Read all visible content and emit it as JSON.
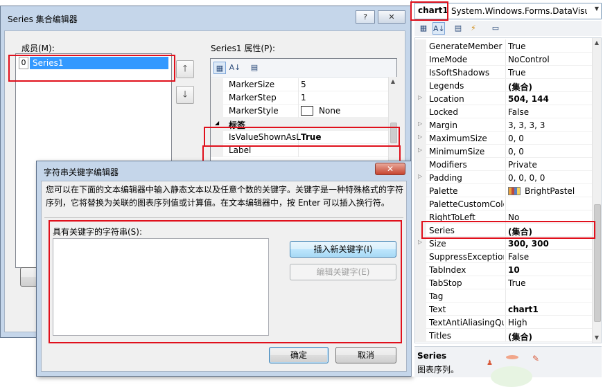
{
  "series_editor": {
    "title": "Series 集合编辑器",
    "help_button": "?",
    "close_button": "✕",
    "members_label": "成员(M):",
    "members": [
      {
        "index": "0",
        "name": "Series1"
      }
    ],
    "properties_label": "Series1 属性(P):",
    "properties": [
      {
        "name": "MarkerSize",
        "value": "5"
      },
      {
        "name": "MarkerStep",
        "value": "1"
      },
      {
        "name": "MarkerStyle",
        "value": "None"
      }
    ],
    "category_label": "标签",
    "is_value_shown": {
      "name": "IsValueShownAsL",
      "value": "True"
    },
    "label_prop": {
      "name": "Label",
      "value": ""
    }
  },
  "keyword_editor": {
    "title": "字符串关键字编辑器",
    "description": "您可以在下面的文本编辑器中输入静态文本以及任意个数的关键字。关键字是一种特殊格式的字符序列，它将替换为关联的图表序列值或计算值。在文本编辑器中，按 Enter 可以插入换行符。",
    "string_label": "具有关键字的字符串(S):",
    "text_value": "",
    "insert_button": "插入新关键字(I)",
    "edit_button": "编辑关键字(E)",
    "ok_button": "确定",
    "cancel_button": "取消"
  },
  "properties_window": {
    "object_name": "chart1",
    "object_type": "System.Windows.Forms.DataVisualiz",
    "rows": [
      {
        "name": "GenerateMember",
        "value": "True",
        "bold": false,
        "expandable": false
      },
      {
        "name": "ImeMode",
        "value": "NoControl",
        "bold": false,
        "expandable": false
      },
      {
        "name": "IsSoftShadows",
        "value": "True",
        "bold": false,
        "expandable": false
      },
      {
        "name": "Legends",
        "value": "(集合)",
        "bold": true,
        "expandable": false
      },
      {
        "name": "Location",
        "value": "504, 144",
        "bold": true,
        "expandable": true
      },
      {
        "name": "Locked",
        "value": "False",
        "bold": false,
        "expandable": false
      },
      {
        "name": "Margin",
        "value": "3, 3, 3, 3",
        "bold": false,
        "expandable": true
      },
      {
        "name": "MaximumSize",
        "value": "0, 0",
        "bold": false,
        "expandable": true
      },
      {
        "name": "MinimumSize",
        "value": "0, 0",
        "bold": false,
        "expandable": true
      },
      {
        "name": "Modifiers",
        "value": "Private",
        "bold": false,
        "expandable": false
      },
      {
        "name": "Padding",
        "value": "0, 0, 0, 0",
        "bold": false,
        "expandable": true
      },
      {
        "name": "Palette",
        "value": "BrightPastel",
        "bold": false,
        "expandable": false
      },
      {
        "name": "PaletteCustomColo",
        "value": "",
        "bold": false,
        "expandable": false
      },
      {
        "name": "RightToLeft",
        "value": "No",
        "bold": false,
        "expandable": false
      },
      {
        "name": "Series",
        "value": "(集合)",
        "bold": true,
        "expandable": false
      },
      {
        "name": "Size",
        "value": "300, 300",
        "bold": true,
        "expandable": true
      },
      {
        "name": "SuppressExceptions",
        "value": "False",
        "bold": false,
        "expandable": false
      },
      {
        "name": "TabIndex",
        "value": "10",
        "bold": true,
        "expandable": false
      },
      {
        "name": "TabStop",
        "value": "True",
        "bold": false,
        "expandable": false
      },
      {
        "name": "Tag",
        "value": "",
        "bold": false,
        "expandable": false
      },
      {
        "name": "Text",
        "value": "chart1",
        "bold": true,
        "expandable": false
      },
      {
        "name": "TextAntiAliasingQu",
        "value": "High",
        "bold": false,
        "expandable": false
      },
      {
        "name": "Titles",
        "value": "(集合)",
        "bold": true,
        "expandable": false
      }
    ],
    "description_title": "Series",
    "description_text": "图表序列。"
  },
  "colors": {
    "highlight": "#e0101c",
    "selection": "#3399ff"
  }
}
